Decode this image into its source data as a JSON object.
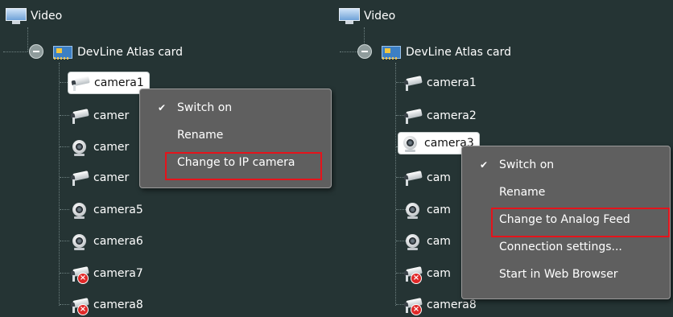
{
  "left_panel": {
    "root_label": "Video",
    "card_label": "DevLine Atlas card",
    "cameras": [
      {
        "label": "camera1",
        "icon": "analog-camera-icon",
        "selected": true
      },
      {
        "label": "camer",
        "icon": "analog-camera-icon"
      },
      {
        "label": "camer",
        "icon": "webcam-icon"
      },
      {
        "label": "camer",
        "icon": "analog-camera-icon"
      },
      {
        "label": "camera5",
        "icon": "webcam-icon"
      },
      {
        "label": "camera6",
        "icon": "webcam-icon"
      },
      {
        "label": "camera7",
        "icon": "camera-error-icon"
      },
      {
        "label": "camera8",
        "icon": "camera-error-icon"
      }
    ],
    "context_menu": {
      "items": [
        {
          "label": "Switch on",
          "checked": true
        },
        {
          "label": "Rename"
        },
        {
          "label": "Change to IP camera",
          "highlighted": true
        }
      ]
    }
  },
  "right_panel": {
    "root_label": "Video",
    "card_label": "DevLine Atlas card",
    "cameras": [
      {
        "label": "camera1",
        "icon": "analog-camera-icon"
      },
      {
        "label": "camera2",
        "icon": "analog-camera-icon"
      },
      {
        "label": "camera3",
        "icon": "webcam-icon",
        "selected": true
      },
      {
        "label": "cam",
        "icon": "analog-camera-icon"
      },
      {
        "label": "cam",
        "icon": "webcam-icon"
      },
      {
        "label": "cam",
        "icon": "webcam-icon"
      },
      {
        "label": "cam",
        "icon": "camera-error-icon"
      },
      {
        "label": "camera8",
        "icon": "camera-error-icon"
      }
    ],
    "context_menu": {
      "items": [
        {
          "label": "Switch on",
          "checked": true
        },
        {
          "label": "Rename"
        },
        {
          "label": "Change to Analog Feed",
          "highlighted": true
        },
        {
          "label": "Connection settings..."
        },
        {
          "label": "Start in Web Browser"
        }
      ]
    }
  },
  "colors": {
    "background": "#253434",
    "menu_background": "#5f5f5f",
    "highlight_border": "#e5131b"
  }
}
